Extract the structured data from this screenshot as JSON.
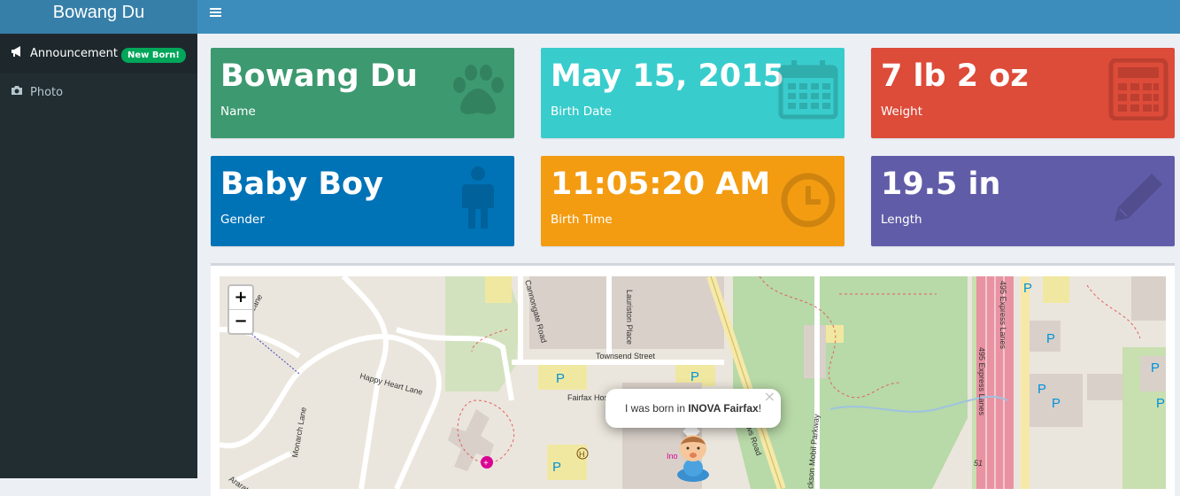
{
  "app": {
    "title": "Bowang Du"
  },
  "header": {
    "menu_icon": "hamburger-icon"
  },
  "sidebar": {
    "items": [
      {
        "label": "Announcement",
        "icon": "bullhorn-icon",
        "badge": "New Born!",
        "active": true
      },
      {
        "label": "Photo",
        "icon": "camera-icon",
        "active": false
      }
    ]
  },
  "info_boxes": [
    {
      "value": "Bowang Du",
      "label": "Name",
      "icon": "paw-icon",
      "color": "#3d9970"
    },
    {
      "value": "May 15, 2015",
      "label": "Birth Date",
      "icon": "calendar-icon",
      "color": "#39cccc"
    },
    {
      "value": "7 lb 2 oz",
      "label": "Weight",
      "icon": "calculator-icon",
      "color": "#dd4b39"
    },
    {
      "value": "Baby Boy",
      "label": "Gender",
      "icon": "male-icon",
      "color": "#0073b7"
    },
    {
      "value": "11:05:20 AM",
      "label": "Birth Time",
      "icon": "clock-icon",
      "color": "#f39c12"
    },
    {
      "value": "19.5 in",
      "label": "Length",
      "icon": "pencil-icon",
      "color": "#605ca8"
    }
  ],
  "map": {
    "zoom_in": "+",
    "zoom_out": "−",
    "popup": {
      "prefix": "I was born in ",
      "place": "INOVA Fairfax",
      "suffix": "!",
      "close": "×"
    },
    "marker_icon": "baby-icon",
    "labels": {
      "happy_heart": "Happy Heart Lane",
      "monarch": "Monarch Lane",
      "cannongate": "Cannongate Road",
      "lauriston": "Lauriston Place",
      "townsend": "Townsend Street",
      "fairfax_hos": "Fairfax Hos",
      "ararat": "Ararat Court",
      "land_lane": "and Lane",
      "mobil": "ckson Mobil Parkway",
      "express": "495 Express Lanes",
      "express2": "495 Express Lanes",
      "ws_road": "ws Road",
      "road51": "51",
      "parking": "P",
      "hospital": "H",
      "inova": "Ino"
    }
  }
}
